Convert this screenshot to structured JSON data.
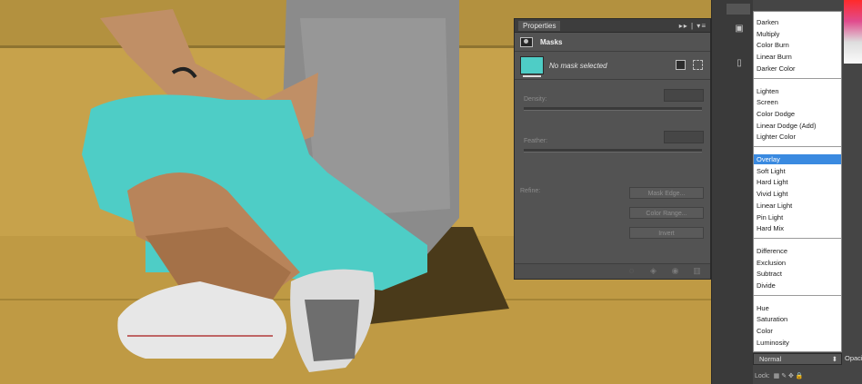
{
  "properties": {
    "title": "Properties",
    "title_icons": "▸▸ | ▾≡",
    "section": "Masks",
    "mask_status": "No mask selected",
    "density_label": "Density:",
    "feather_label": "Feather:",
    "refine_label": "Refine:",
    "buttons": {
      "mask_edge": "Mask Edge...",
      "color_range": "Color Range...",
      "invert": "Invert"
    }
  },
  "blend_modes": {
    "groups": [
      [
        "Darken",
        "Multiply",
        "Color Burn",
        "Linear Burn",
        "Darker Color"
      ],
      [
        "Lighten",
        "Screen",
        "Color Dodge",
        "Linear Dodge (Add)",
        "Lighter Color"
      ],
      [
        "Overlay",
        "Soft Light",
        "Hard Light",
        "Vivid Light",
        "Linear Light",
        "Pin Light",
        "Hard Mix"
      ],
      [
        "Difference",
        "Exclusion",
        "Subtract",
        "Divide"
      ],
      [
        "Hue",
        "Saturation",
        "Color",
        "Luminosity"
      ]
    ],
    "selected": "Overlay",
    "current": "Normal"
  },
  "layers": {
    "opacity_label": "Opacity",
    "locks_label": "Lock:"
  },
  "colors": {
    "mask_overlay": "#4ecdc6",
    "background_wall": "#c9a44c",
    "accent": "#3a8ae0"
  }
}
